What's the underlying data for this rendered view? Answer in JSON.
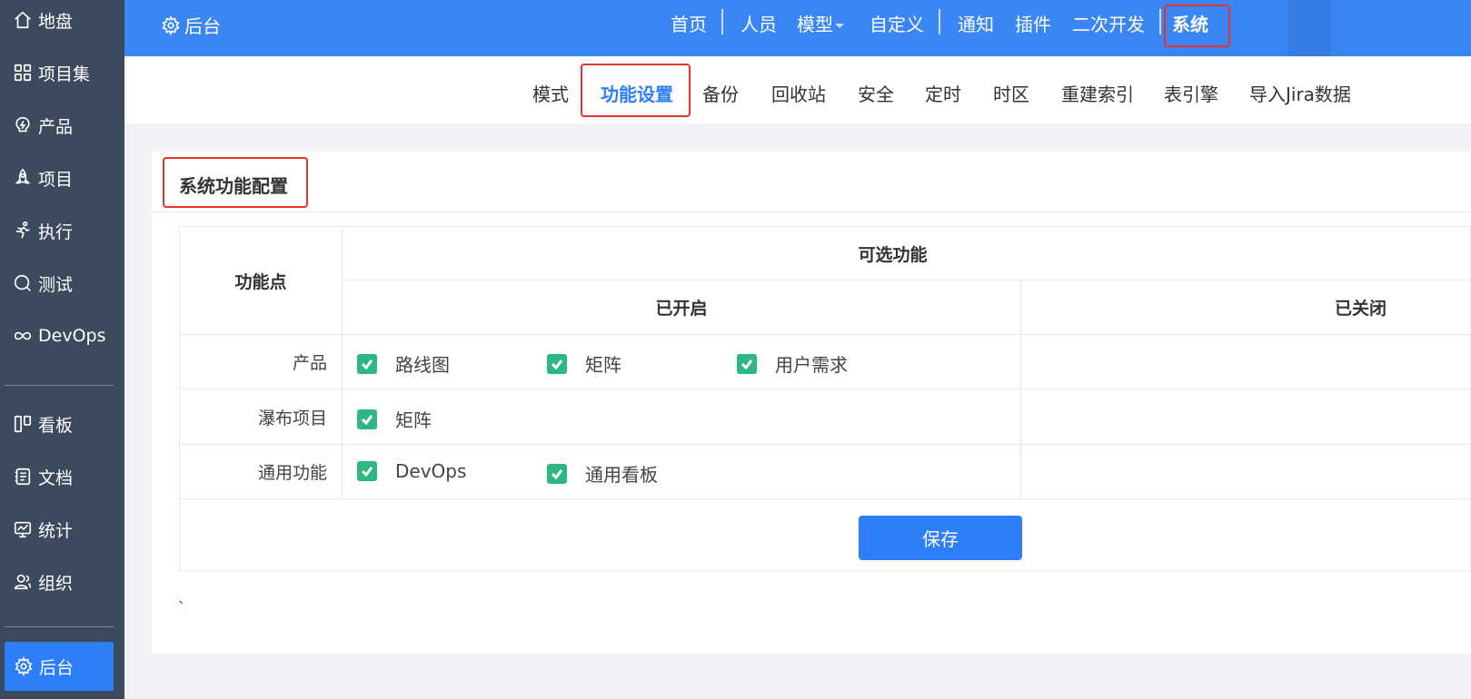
{
  "sidebar": {
    "items": [
      {
        "label": "地盘",
        "icon": "home-icon"
      },
      {
        "label": "项目集",
        "icon": "grid-icon"
      },
      {
        "label": "产品",
        "icon": "lightbulb-icon"
      },
      {
        "label": "项目",
        "icon": "rocket-icon"
      },
      {
        "label": "执行",
        "icon": "running-icon"
      },
      {
        "label": "测试",
        "icon": "magnifier-icon"
      },
      {
        "label": "DevOps",
        "icon": "infinity-icon"
      },
      {
        "label": "看板",
        "icon": "kanban-icon"
      },
      {
        "label": "文档",
        "icon": "document-icon"
      },
      {
        "label": "统计",
        "icon": "monitor-icon"
      },
      {
        "label": "组织",
        "icon": "people-icon"
      }
    ],
    "active": {
      "label": "后台",
      "icon": "gear-icon"
    }
  },
  "topbar": {
    "brand": "后台",
    "nav": [
      "首页",
      "人员",
      "模型",
      "自定义",
      "通知",
      "插件",
      "二次开发",
      "系统"
    ],
    "active": "系统"
  },
  "subnav": {
    "tabs": [
      "模式",
      "功能设置",
      "备份",
      "回收站",
      "安全",
      "定时",
      "时区",
      "重建索引",
      "表引擎",
      "导入Jira数据"
    ],
    "active": "功能设置"
  },
  "card": {
    "title": "系统功能配置",
    "table": {
      "col_feature": "功能点",
      "col_optional": "可选功能",
      "col_enabled": "已开启",
      "col_disabled": "已关闭",
      "rows": [
        {
          "label": "产品",
          "enabled": [
            "路线图",
            "矩阵",
            "用户需求"
          ]
        },
        {
          "label": "瀑布项目",
          "enabled": [
            "矩阵"
          ]
        },
        {
          "label": "通用功能",
          "enabled": [
            "DevOps",
            "通用看板"
          ]
        }
      ]
    },
    "save_label": "保存",
    "stray_mark": "`"
  },
  "colors": {
    "sidebar": "#3c4a5e",
    "topbar": "#3b86f5",
    "accent": "#2d7ef7",
    "checkbox": "#2db783",
    "highlight": "#e5322d"
  }
}
